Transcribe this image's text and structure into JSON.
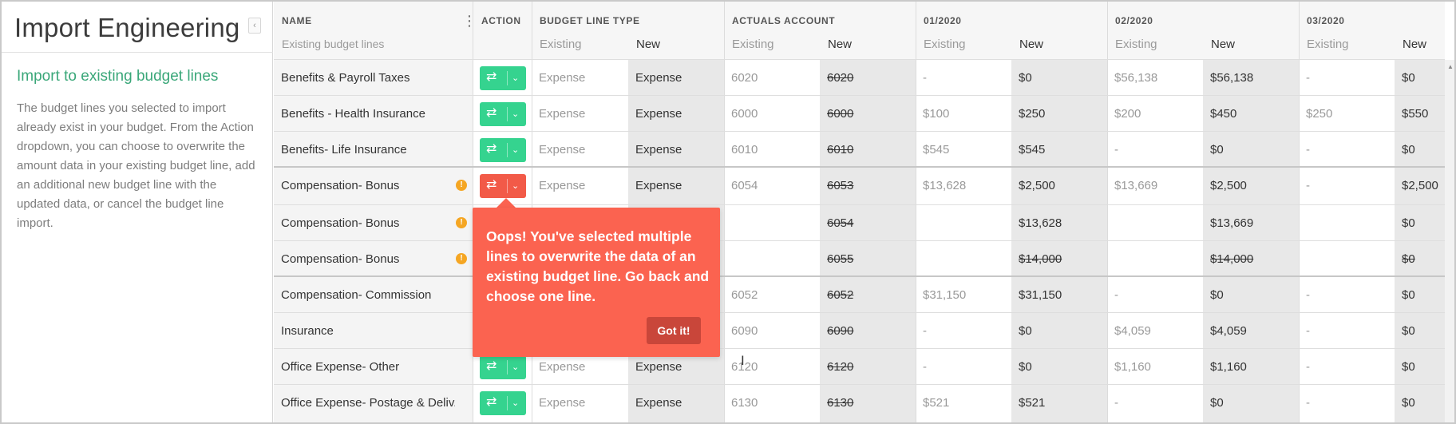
{
  "app": {
    "title": "Import Engineering",
    "collapse_icon": "‹"
  },
  "sidebar": {
    "heading": "Import to existing budget lines",
    "description": "The budget lines you selected to import already exist in your budget. From the Action dropdown, you can choose to overwrite the amount data in your existing budget line, add an additional new budget line with the updated data, or cancel the budget line import."
  },
  "grid": {
    "headers": {
      "name": "NAME",
      "name_sub": "Existing budget lines",
      "action": "ACTION",
      "budget_line_type": "BUDGET LINE TYPE",
      "actuals_account": "ACTUALS ACCOUNT",
      "months": [
        "01/2020",
        "02/2020",
        "03/2020"
      ],
      "existing": "Existing",
      "new": "New"
    },
    "rows": [
      {
        "name": "Benefits & Payroll Taxes",
        "action": "ok",
        "warn": false,
        "type_existing": "Expense",
        "type_new": "Expense",
        "acct_existing": "6020",
        "acct_new": "6020",
        "acct_new_strike": true,
        "m1_existing": "-",
        "m1_new": "$0",
        "m1_new_strike": false,
        "m2_existing": "$56,138",
        "m2_new": "$56,138",
        "m2_new_strike": false,
        "m3_existing": "-",
        "m3_new": "$0",
        "m3_new_strike": false
      },
      {
        "name": "Benefits - Health Insurance",
        "action": "ok",
        "warn": false,
        "type_existing": "Expense",
        "type_new": "Expense",
        "acct_existing": "6000",
        "acct_new": "6000",
        "acct_new_strike": true,
        "m1_existing": "$100",
        "m1_new": "$250",
        "m1_new_strike": false,
        "m2_existing": "$200",
        "m2_new": "$450",
        "m2_new_strike": false,
        "m3_existing": "$250",
        "m3_new": "$550",
        "m3_new_strike": false
      },
      {
        "name": "Benefits- Life Insurance",
        "action": "ok",
        "warn": false,
        "type_existing": "Expense",
        "type_new": "Expense",
        "acct_existing": "6010",
        "acct_new": "6010",
        "acct_new_strike": true,
        "m1_existing": "$545",
        "m1_new": "$545",
        "m1_new_strike": false,
        "m2_existing": "-",
        "m2_new": "$0",
        "m2_new_strike": false,
        "m3_existing": "-",
        "m3_new": "$0",
        "m3_new_strike": false
      },
      {
        "name": "Compensation- Bonus",
        "action": "error",
        "warn": true,
        "type_existing": "Expense",
        "type_new": "Expense",
        "acct_existing": "6054",
        "acct_new": "6053",
        "acct_new_strike": true,
        "m1_existing": "$13,628",
        "m1_new": "$2,500",
        "m1_new_strike": false,
        "m2_existing": "$13,669",
        "m2_new": "$2,500",
        "m2_new_strike": false,
        "m3_existing": "-",
        "m3_new": "$2,500",
        "m3_new_strike": false
      },
      {
        "name": "Compensation- Bonus",
        "action": "none",
        "warn": true,
        "type_existing": "",
        "type_new": "",
        "acct_existing": "",
        "acct_new": "6054",
        "acct_new_strike": true,
        "m1_existing": "",
        "m1_new": "$13,628",
        "m1_new_strike": false,
        "m2_existing": "",
        "m2_new": "$13,669",
        "m2_new_strike": false,
        "m3_existing": "",
        "m3_new": "$0",
        "m3_new_strike": false
      },
      {
        "name": "Compensation- Bonus",
        "action": "none",
        "warn": true,
        "type_existing": "",
        "type_new": "",
        "acct_existing": "",
        "acct_new": "6055",
        "acct_new_strike": true,
        "m1_existing": "",
        "m1_new": "$14,000",
        "m1_new_strike": true,
        "m2_existing": "",
        "m2_new": "$14,000",
        "m2_new_strike": true,
        "m3_existing": "",
        "m3_new": "$0",
        "m3_new_strike": true
      },
      {
        "name": "Compensation- Commission",
        "action": "hidden",
        "warn": false,
        "type_existing": "",
        "type_new": "",
        "acct_existing": "6052",
        "acct_new": "6052",
        "acct_new_strike": true,
        "m1_existing": "$31,150",
        "m1_new": "$31,150",
        "m1_new_strike": false,
        "m2_existing": "-",
        "m2_new": "$0",
        "m2_new_strike": false,
        "m3_existing": "-",
        "m3_new": "$0",
        "m3_new_strike": false
      },
      {
        "name": "Insurance",
        "action": "hidden",
        "warn": false,
        "type_existing": "",
        "type_new": "",
        "acct_existing": "6090",
        "acct_new": "6090",
        "acct_new_strike": true,
        "m1_existing": "-",
        "m1_new": "$0",
        "m1_new_strike": false,
        "m2_existing": "$4,059",
        "m2_new": "$4,059",
        "m2_new_strike": false,
        "m3_existing": "-",
        "m3_new": "$0",
        "m3_new_strike": false
      },
      {
        "name": "Office Expense- Other",
        "action": "ok",
        "warn": false,
        "type_existing": "Expense",
        "type_new": "Expense",
        "acct_existing": "6120",
        "acct_new": "6120",
        "acct_new_strike": true,
        "m1_existing": "-",
        "m1_new": "$0",
        "m1_new_strike": false,
        "m2_existing": "$1,160",
        "m2_new": "$1,160",
        "m2_new_strike": false,
        "m3_existing": "-",
        "m3_new": "$0",
        "m3_new_strike": false
      },
      {
        "name": "Office Expense- Postage & Deliv...",
        "action": "ok",
        "warn": false,
        "type_existing": "Expense",
        "type_new": "Expense",
        "acct_existing": "6130",
        "acct_new": "6130",
        "acct_new_strike": true,
        "m1_existing": "$521",
        "m1_new": "$521",
        "m1_new_strike": false,
        "m2_existing": "-",
        "m2_new": "$0",
        "m2_new_strike": false,
        "m3_existing": "-",
        "m3_new": "$0",
        "m3_new_strike": false
      }
    ]
  },
  "tooltip": {
    "message": "Oops! You've selected multiple lines to overwrite the data of an existing budget line. Go back and choose one line.",
    "button": "Got it!"
  },
  "icons": {
    "swap": "⇄",
    "chevron": "⌄",
    "warning": "!",
    "kebab": "⋮",
    "scroll_up": "▲",
    "text_cursor": "I"
  },
  "colors": {
    "accent_green": "#35d38f",
    "heading_green": "#3aa779",
    "error_red": "#f25a48",
    "tooltip_red": "#fb6350",
    "warning_orange": "#f5a623"
  }
}
